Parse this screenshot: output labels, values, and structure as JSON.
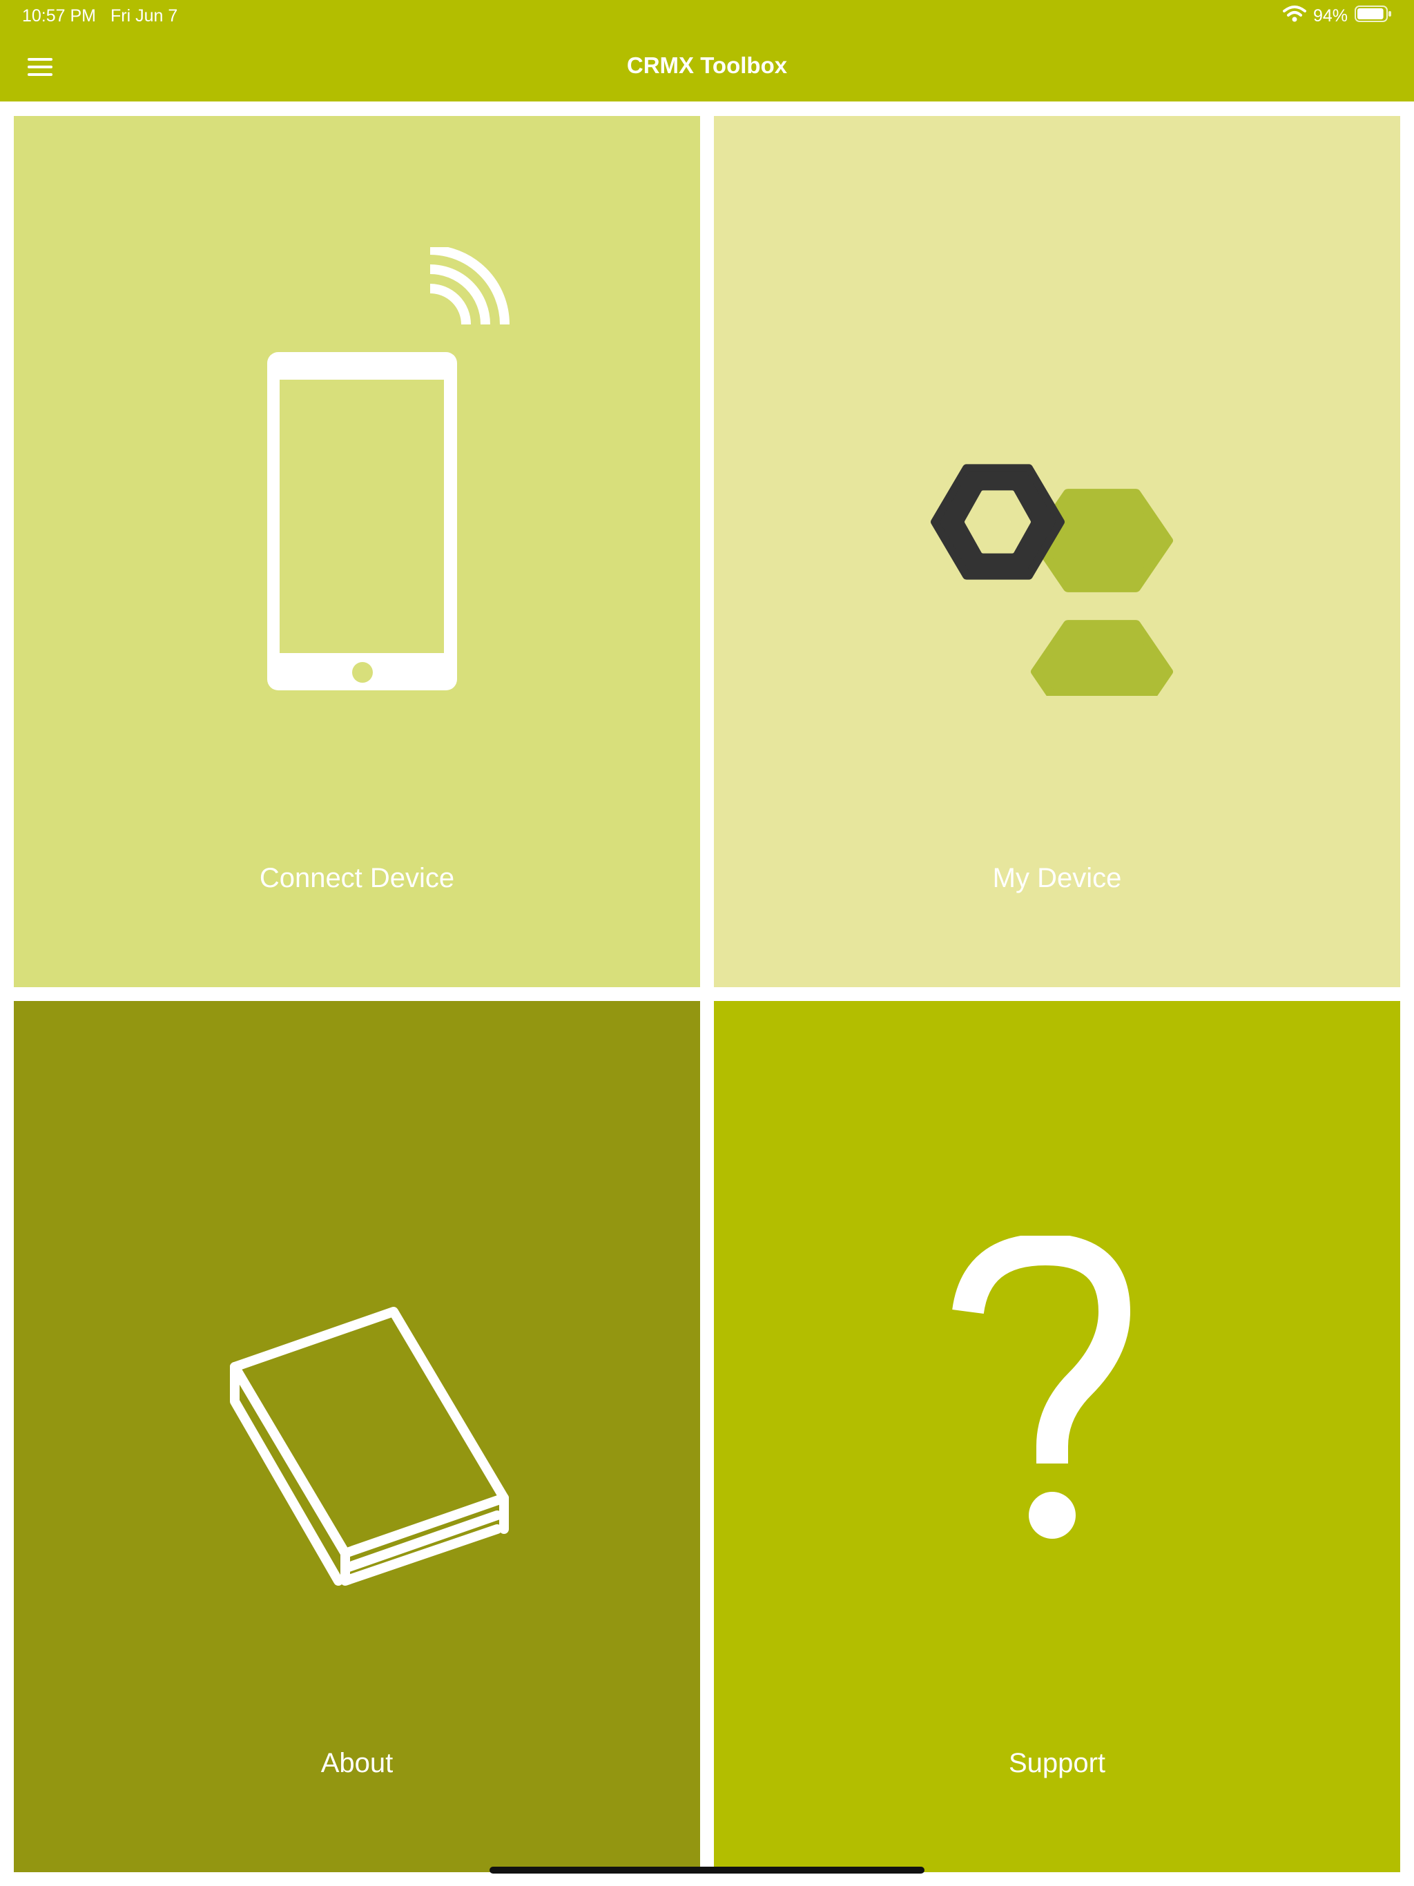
{
  "status_bar": {
    "time": "10:57 PM",
    "date": "Fri Jun 7",
    "battery": "94%",
    "battery_level": 0.94,
    "wifi_icon": "wifi-icon",
    "battery_icon": "battery-icon"
  },
  "nav": {
    "title": "CRMX Toolbox",
    "menu_icon": "hamburger-menu-icon"
  },
  "tiles": [
    {
      "label": "Connect Device",
      "icon": "tablet-wireless-icon",
      "color": "#d8df7b"
    },
    {
      "label": "My Device",
      "icon": "hexagon-cluster-icon",
      "color": "#e7e69d"
    },
    {
      "label": "About",
      "icon": "book-icon",
      "color": "#939611"
    },
    {
      "label": "Support",
      "icon": "question-mark-icon",
      "color": "#b3be00"
    }
  ],
  "colors": {
    "brand": "#b3be00",
    "hex_accent": "#aebd36",
    "hex_dark": "#333333"
  }
}
